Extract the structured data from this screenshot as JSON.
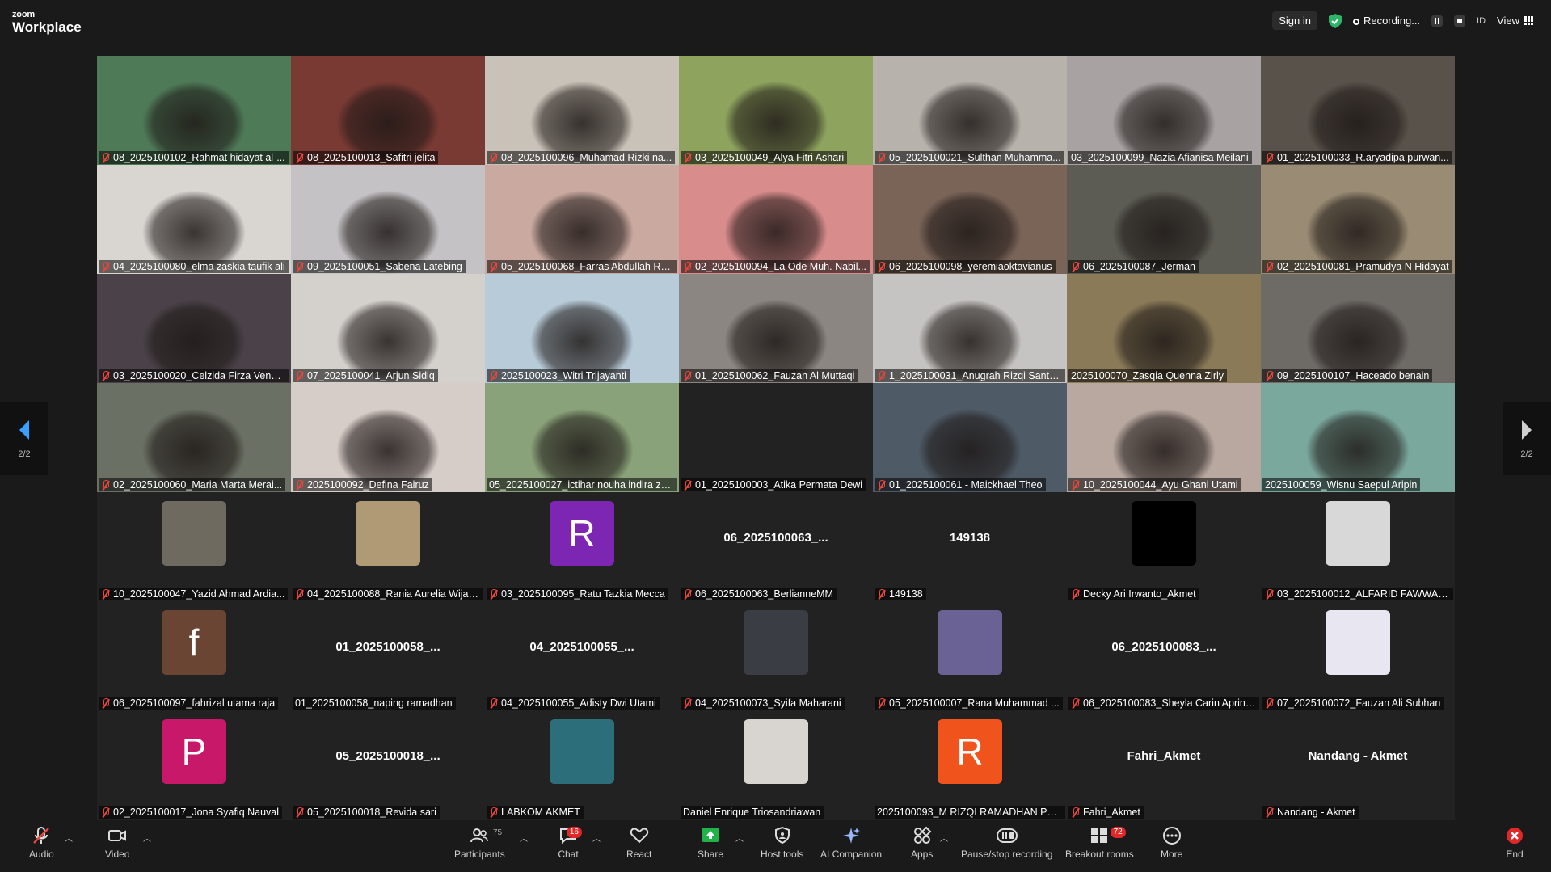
{
  "app": {
    "logo_small": "zoom",
    "logo_main": "Workplace"
  },
  "topbar": {
    "sign_in": "Sign in",
    "recording": "Recording...",
    "lang": "ID",
    "view": "View"
  },
  "pager": {
    "left_page": "2/2",
    "right_page": "2/2"
  },
  "tiles": [
    {
      "name": "08_2025100102_Rahmat hidayat al-...",
      "bg": "#4e7a58",
      "muted": true
    },
    {
      "name": "08_2025100013_Safitri jelita",
      "bg": "#7a3a34",
      "muted": true
    },
    {
      "name": "08_2025100096_Muhamad Rizki na...",
      "bg": "#c9c2b8",
      "muted": true
    },
    {
      "name": "03_2025100049_Alya Fitri Ashari",
      "bg": "#8ea35e",
      "muted": true
    },
    {
      "name": "05_2025100021_Sulthan Muhamma...",
      "bg": "#b7b2ac",
      "muted": true
    },
    {
      "name": "03_2025100099_Nazia Afianisa Meilani",
      "bg": "#a8a3a2",
      "muted": false
    },
    {
      "name": "01_2025100033_R.aryadipa purwan...",
      "bg": "#59524b",
      "muted": true
    },
    {
      "name": "04_2025100080_elma zaskia taufik ali",
      "bg": "#d9d6d2",
      "muted": true
    },
    {
      "name": "09_2025100051_Sabena Latebing",
      "bg": "#c4c2c4",
      "muted": true
    },
    {
      "name": "05_2025100068_Farras Abdullah Ra...",
      "bg": "#c9a9a0",
      "muted": true
    },
    {
      "name": "02_2025100094_La Ode Muh. Nabil...",
      "bg": "#d98c8c",
      "muted": true
    },
    {
      "name": "06_2025100098_yeremiaoktavianus",
      "bg": "#7a6458",
      "muted": true
    },
    {
      "name": "06_2025100087_Jerman",
      "bg": "#5c5c54",
      "muted": true
    },
    {
      "name": "02_2025100081_Pramudya N Hidayat",
      "bg": "#9a8c74",
      "muted": true
    },
    {
      "name": "03_2025100020_Celzida Firza Venus...",
      "bg": "#4a4248",
      "muted": true
    },
    {
      "name": "07_2025100041_Arjun Sidiq",
      "bg": "#d4d0cc",
      "muted": true
    },
    {
      "name": "2025100023_Witri Trijayanti",
      "bg": "#b8cbd8",
      "muted": true
    },
    {
      "name": "01_2025100062_Fauzan Al Muttaqi",
      "bg": "#8c8682",
      "muted": true
    },
    {
      "name": "1_2025100031_Anugrah Rizqi Santo...",
      "bg": "#c6c4c2",
      "muted": true
    },
    {
      "name": "2025100070_Zasqia Quenna Zirly",
      "bg": "#8a7a58",
      "muted": false
    },
    {
      "name": "09_2025100107_Haceado benain",
      "bg": "#6e6a66",
      "muted": true
    },
    {
      "name": "02_2025100060_Maria Marta Merai...",
      "bg": "#6a7064",
      "muted": true
    },
    {
      "name": "2025100092_Defina Fairuz",
      "bg": "#d6ccc8",
      "muted": true
    },
    {
      "name": "05_2025100027_ictihar nouha indira za...",
      "bg": "#8aa27a",
      "muted": false
    },
    {
      "name": "01_2025100003_Atika Permata Dewi",
      "bg": "#222222",
      "muted": true
    },
    {
      "name": "01_2025100061 - Maickhael Theo",
      "bg": "#4e5a66",
      "muted": true
    },
    {
      "name": "10_2025100044_Ayu Ghani Utami",
      "bg": "#b8a8a0",
      "muted": true
    },
    {
      "name": "2025100059_Wisnu Saepul Aripin",
      "bg": "#7aa89c",
      "muted": false
    },
    {
      "name": "10_2025100047_Yazid Ahmad Ardia...",
      "bg": "#222222",
      "avatar_bg": "#6e6a60",
      "muted": true
    },
    {
      "name": "04_2025100088_Rania Aurelia Wijay...",
      "bg": "#222222",
      "avatar_bg": "#b09a76",
      "muted": true
    },
    {
      "name": "03_2025100095_Ratu Tazkia Mecca",
      "bg": "#222222",
      "avatar_bg": "#7d26b3",
      "letter": "R",
      "muted": true
    },
    {
      "name": "06_2025100063_BerlianneMM",
      "bg": "#222222",
      "center": "06_2025100063_...",
      "muted": true
    },
    {
      "name": "149138",
      "bg": "#222222",
      "center": "149138",
      "muted": true
    },
    {
      "name": "Decky Ari Irwanto_Akmet",
      "bg": "#222222",
      "avatar_bg": "#000000",
      "muted": true
    },
    {
      "name": "03_2025100012_ALFARID FAWWAZ P...",
      "bg": "#222222",
      "avatar_bg": "#d8d8d8",
      "muted": true
    },
    {
      "name": "06_2025100097_fahrizal utama raja",
      "bg": "#222222",
      "avatar_bg": "#6b4534",
      "letter": "f",
      "muted": true
    },
    {
      "name": "01_2025100058_naping ramadhan",
      "bg": "#222222",
      "center": "01_2025100058_...",
      "muted": false
    },
    {
      "name": "04_2025100055_Adisty Dwi Utami",
      "bg": "#222222",
      "center": "04_2025100055_...",
      "muted": true
    },
    {
      "name": "04_2025100073_Syifa Maharani",
      "bg": "#222222",
      "avatar_bg": "#3a3e44",
      "muted": true
    },
    {
      "name": "05_2025100007_Rana Muhammad ...",
      "bg": "#222222",
      "avatar_bg": "#6a6294",
      "muted": true
    },
    {
      "name": "06_2025100083_Sheyla Carin Aprinda",
      "bg": "#222222",
      "center": "06_2025100083_...",
      "muted": true
    },
    {
      "name": "07_2025100072_Fauzan Ali Subhan",
      "bg": "#222222",
      "avatar_bg": "#e8e6f0",
      "muted": true
    },
    {
      "name": "02_2025100017_Jona Syafiq Nauval",
      "bg": "#222222",
      "avatar_bg": "#c8186a",
      "letter": "P",
      "muted": true
    },
    {
      "name": "05_2025100018_Revida sari",
      "bg": "#222222",
      "center": "05_2025100018_...",
      "muted": true
    },
    {
      "name": "LABKOM AKMET",
      "bg": "#222222",
      "avatar_bg": "#2c6e7a",
      "muted": true
    },
    {
      "name": "Daniel Enrique Triosandriawan",
      "bg": "#222222",
      "avatar_bg": "#d8d4d0",
      "muted": false,
      "active": true
    },
    {
      "name": "2025100093_M RIZQI RAMADHAN PU...",
      "bg": "#222222",
      "avatar_bg": "#f0541c",
      "letter": "R",
      "muted": false
    },
    {
      "name": "Fahri_Akmet",
      "bg": "#222222",
      "center": "Fahri_Akmet",
      "muted": true
    },
    {
      "name": "Nandang - Akmet",
      "bg": "#222222",
      "center": "Nandang - Akmet",
      "muted": true
    }
  ],
  "toolbar": {
    "audio": "Audio",
    "video": "Video",
    "participants": "Participants",
    "participants_count": "75",
    "chat": "Chat",
    "chat_badge": "16",
    "react": "React",
    "share": "Share",
    "host_tools": "Host tools",
    "ai_companion": "AI Companion",
    "apps": "Apps",
    "pause_rec": "Pause/stop recording",
    "breakout": "Breakout rooms",
    "breakout_badge": "72",
    "more": "More",
    "end": "End"
  },
  "colors": {
    "accent_green": "#2ecc71",
    "muted_red": "#e8453c",
    "share_green": "#1fb34a",
    "end_red": "#e02828"
  }
}
